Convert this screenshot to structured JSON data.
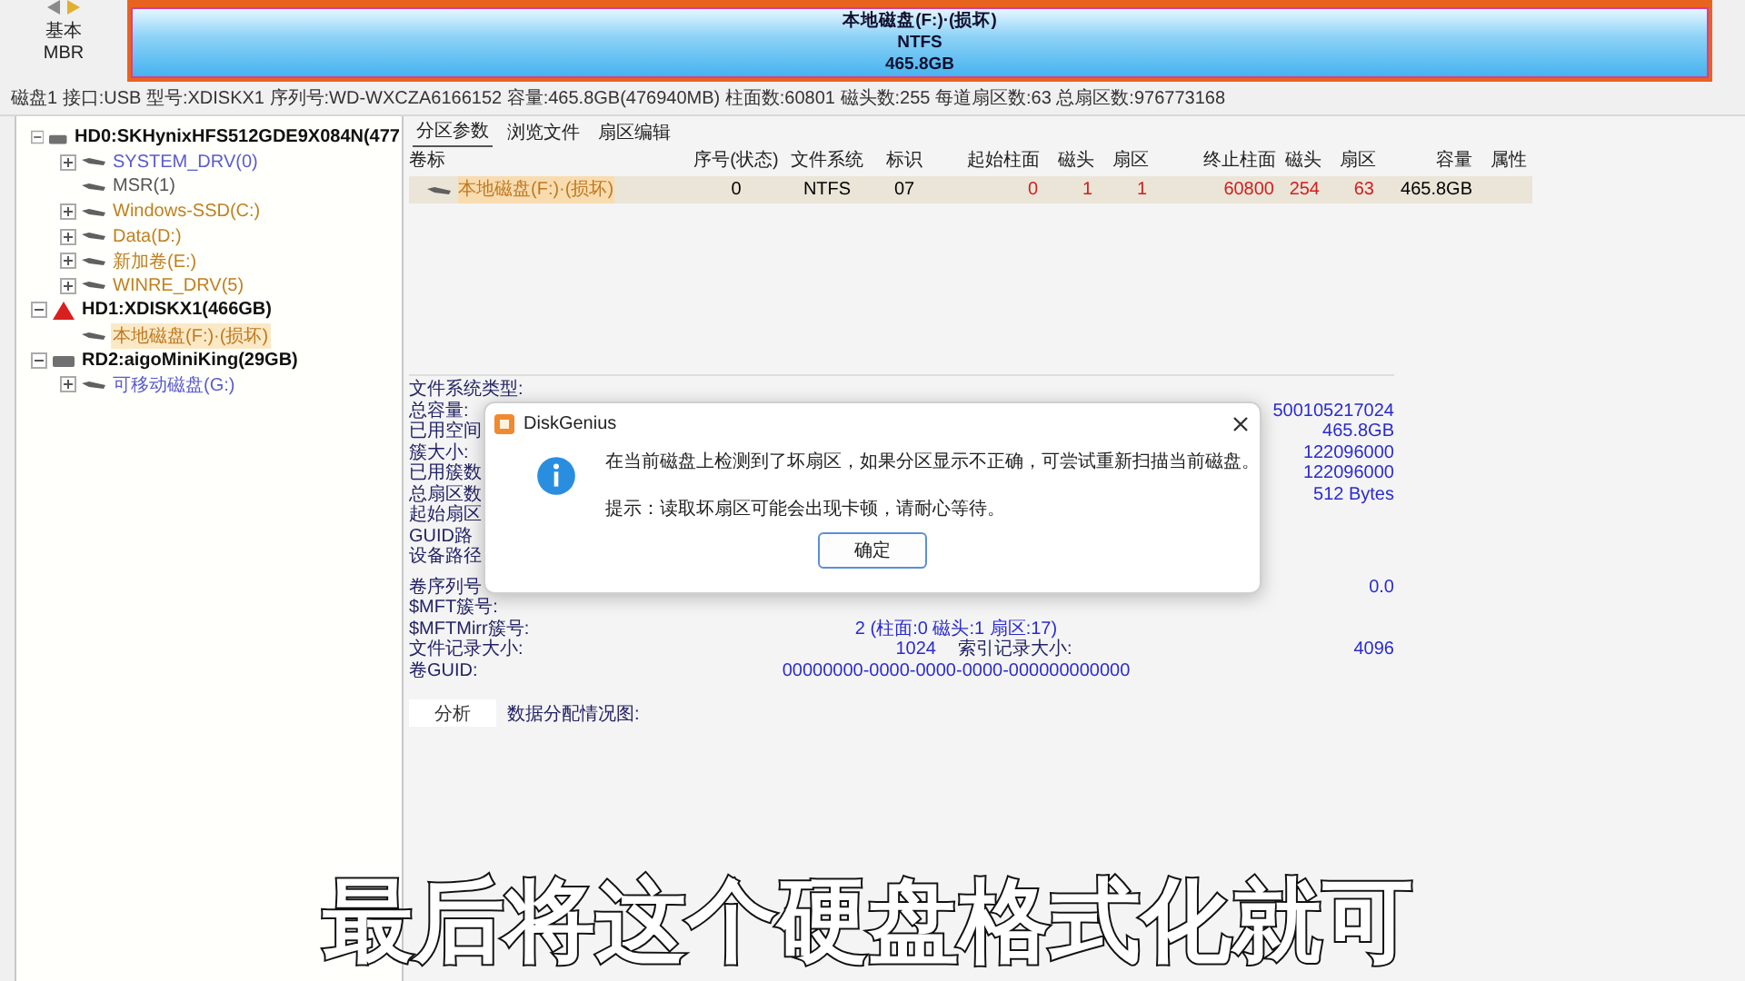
{
  "disk_map": {
    "style": "基本",
    "scheme": "MBR",
    "partition": {
      "label": "本地磁盘(F:)·(损坏)",
      "filesystem": "NTFS",
      "size": "465.8GB"
    }
  },
  "disk_info": "磁盘1 接口:USB 型号:XDISKX1 序列号:WD-WXCZA6166152 容量:465.8GB(476940MB) 柱面数:60801 磁头数:255 每道扇区数:63 总扇区数:976773168",
  "tree": [
    {
      "label": "HD0:SKHynixHFS512GDE9X084N(477",
      "warning": false,
      "expanded": true,
      "selected": false,
      "children": [
        {
          "label": "SYSTEM_DRV(0)",
          "color": "#5a5ad0",
          "expandable": true,
          "expanded": false,
          "selected": false
        },
        {
          "label": "MSR(1)",
          "color": "#555555",
          "expandable": false,
          "selected": false
        },
        {
          "label": "Windows-SSD(C:)",
          "color": "#c08020",
          "expandable": true,
          "expanded": false,
          "selected": false
        },
        {
          "label": "Data(D:)",
          "color": "#c08020",
          "expandable": true,
          "expanded": false,
          "selected": false
        },
        {
          "label": "新加卷(E:)",
          "color": "#c08020",
          "expandable": true,
          "expanded": false,
          "selected": false
        },
        {
          "label": "WINRE_DRV(5)",
          "color": "#c08020",
          "expandable": true,
          "expanded": false,
          "selected": false
        }
      ]
    },
    {
      "label": "HD1:XDISKX1(466GB)",
      "warning": true,
      "expanded": true,
      "selected": false,
      "children": [
        {
          "label": "本地磁盘(F:)·(损坏)",
          "color": "#c07820",
          "expandable": false,
          "selected": true
        }
      ]
    },
    {
      "label": "RD2:aigoMiniKing(29GB)",
      "warning": false,
      "expanded": true,
      "selected": false,
      "children": [
        {
          "label": "可移动磁盘(G:)",
          "color": "#5a5ad0",
          "expandable": true,
          "expanded": false,
          "selected": false
        }
      ]
    }
  ],
  "tabs": [
    {
      "label": "分区参数",
      "selected": true
    },
    {
      "label": "浏览文件",
      "selected": false
    },
    {
      "label": "扇区编辑",
      "selected": false
    }
  ],
  "table": {
    "columns": [
      {
        "label": "卷标",
        "kind": "label"
      },
      {
        "label": "序号(状态)",
        "kind": "center"
      },
      {
        "label": "文件系统",
        "kind": "center"
      },
      {
        "label": "标识",
        "kind": "center"
      },
      {
        "label": "起始柱面",
        "kind": "chs"
      },
      {
        "label": "磁头",
        "kind": "chs"
      },
      {
        "label": "扇区",
        "kind": "chs"
      },
      {
        "label": "终止柱面",
        "kind": "chs"
      },
      {
        "label": "磁头",
        "kind": "chs"
      },
      {
        "label": "扇区",
        "kind": "chs"
      },
      {
        "label": "容量",
        "kind": "number"
      },
      {
        "label": "属性",
        "kind": "number"
      }
    ],
    "rows": [
      {
        "selected": true,
        "cells": [
          "本地磁盘(F:)·(损坏)",
          "0",
          "NTFS",
          "07",
          "0",
          "1",
          "1",
          "60800",
          "254",
          "63",
          "465.8GB",
          ""
        ]
      }
    ]
  },
  "details": [
    {
      "label": "文件系统类型:"
    },
    {
      "label": "总容量:",
      "value2": "500105217024"
    },
    {
      "label": "已用空间",
      "value2": "465.8GB"
    },
    {
      "label": "簇大小:",
      "value2": "122096000"
    },
    {
      "label": "已用簇数",
      "value2": "122096000"
    },
    {
      "label": "总扇区数",
      "value2": "512 Bytes"
    },
    {
      "label": "起始扇区"
    },
    {
      "label": "GUID路"
    },
    {
      "label": "设备路径"
    },
    {
      "label": "卷序列号",
      "value2": "0.0"
    },
    {
      "label": "$MFT簇号:"
    },
    {
      "label": "$MFTMirr簇号:",
      "value": "2 (柱面:0 磁头:1 扇区:17)"
    },
    {
      "label": "文件记录大小:",
      "value": "1024",
      "label2": "索引记录大小:",
      "value2": "4096"
    },
    {
      "label": "卷GUID:",
      "value": "00000000-0000-0000-0000-000000000000"
    }
  ],
  "analysis": {
    "button": "分析",
    "label": "数据分配情况图:"
  },
  "dialog": {
    "title": "DiskGenius",
    "messages": [
      "在当前磁盘上检测到了坏扇区，如果分区显示不正确，可尝试重新扫描当前磁盘。",
      "提示：读取坏扇区可能会出现卡顿，请耐心等待。"
    ],
    "button": "确定"
  },
  "subtitle": "最后将这个硬盘格式化就可"
}
